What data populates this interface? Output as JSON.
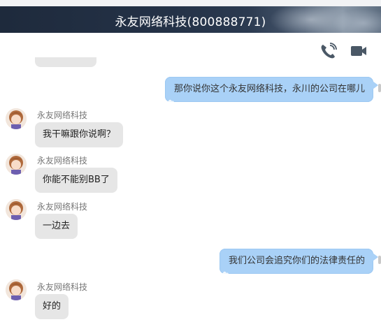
{
  "header": {
    "title": "永友网络科技(800888771)"
  },
  "toolbar": {
    "phone_icon": "phone-icon",
    "video_icon": "video-camera-icon"
  },
  "colors": {
    "header_bg": "#243247",
    "outgoing_bubble": "#a9d1f7",
    "incoming_bubble": "#e6e6e6"
  },
  "messages": [
    {
      "direction": "out",
      "text": "那你说你这个永友网络科技，永川的公司在哪儿"
    },
    {
      "direction": "in",
      "sender": "永友网络科技",
      "text": "我干嘛跟你说啊？"
    },
    {
      "direction": "in",
      "sender": "永友网络科技",
      "text": "你能不能别BB了"
    },
    {
      "direction": "in",
      "sender": "永友网络科技",
      "text": "一边去"
    },
    {
      "direction": "out",
      "text": "我们公司会追究你们的法律责任的"
    },
    {
      "direction": "in",
      "sender": "永友网络科技",
      "text": "好的"
    }
  ]
}
